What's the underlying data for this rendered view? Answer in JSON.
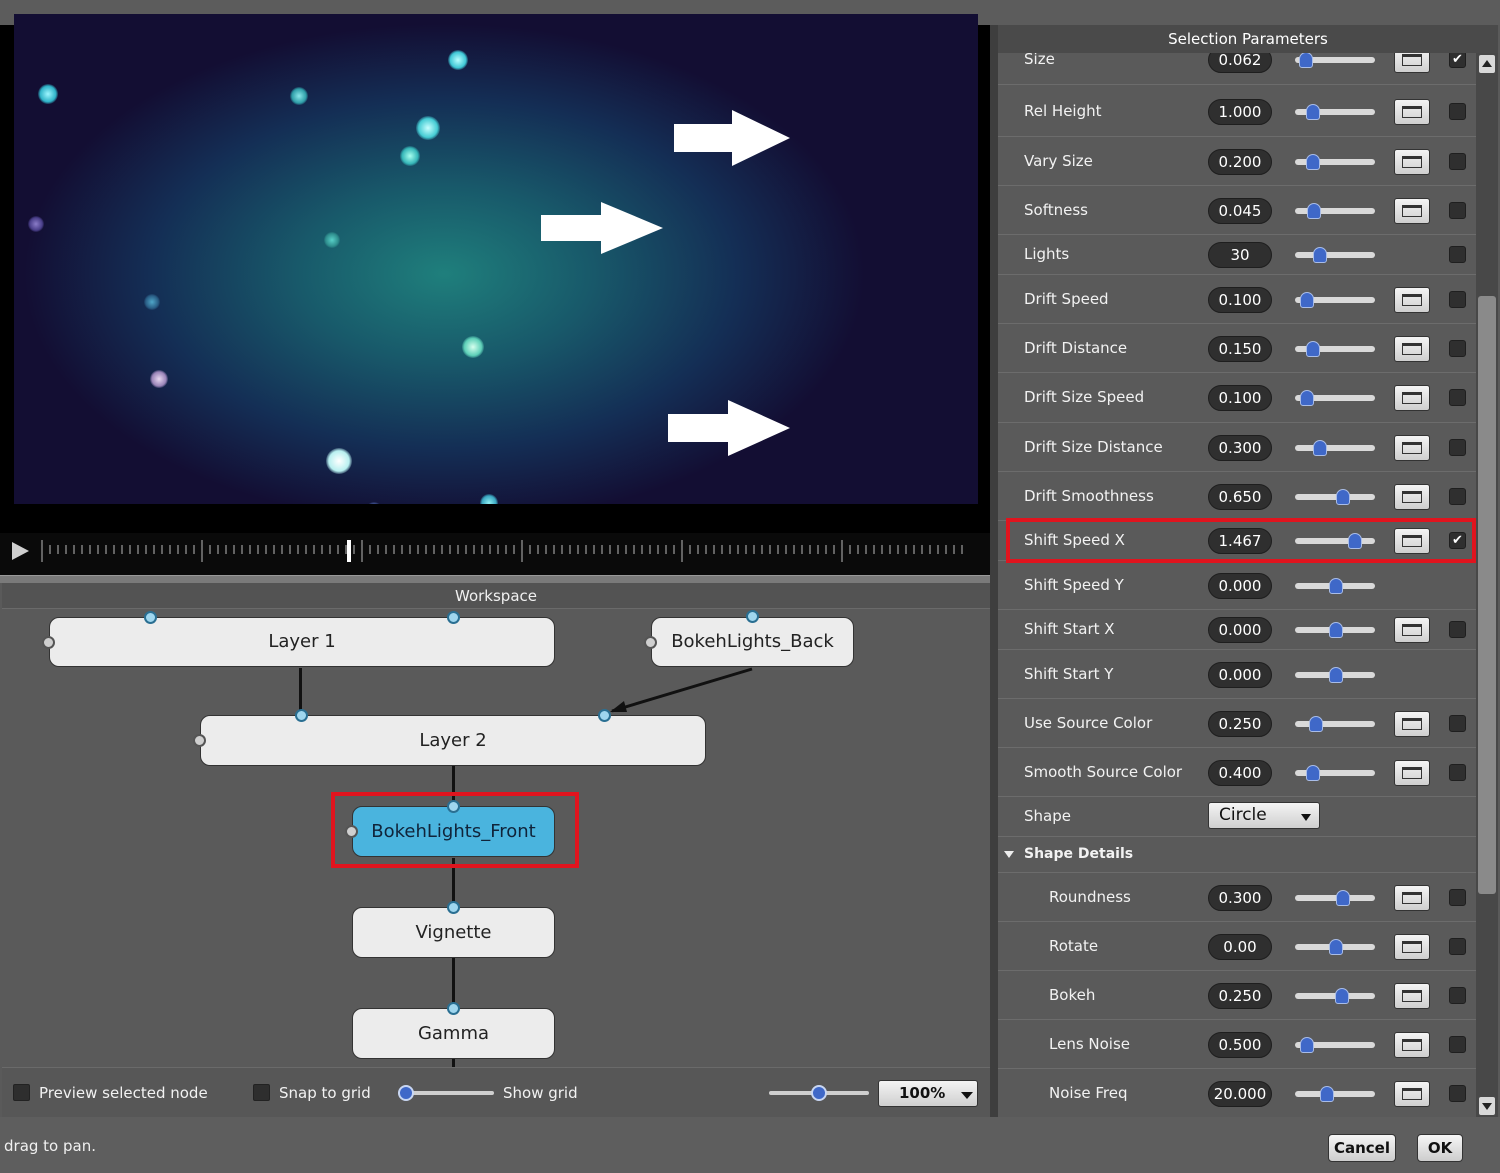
{
  "preview": {
    "arrow_color": "#ffffff",
    "background_colors": [
      "#1f7f7c",
      "#142e55",
      "#130e33"
    ]
  },
  "workspace": {
    "title": "Workspace",
    "nodes": {
      "layer1": "Layer 1",
      "bokeh_back": "BokehLights_Back",
      "layer2": "Layer 2",
      "bokeh_front": "BokehLights_Front",
      "vignette": "Vignette",
      "gamma": "Gamma"
    },
    "selected_node": "BokehLights_Front",
    "footer": {
      "preview_selected_label": "Preview selected node",
      "snap_label": "Snap to grid",
      "show_grid_label": "Show grid",
      "zoom_value": "100%"
    }
  },
  "params": {
    "title": "Selection Parameters",
    "rows": [
      {
        "name": "Size",
        "value": "0.062",
        "checked": true
      },
      {
        "name": "Rel Height",
        "value": "1.000",
        "checked": false
      },
      {
        "name": "Vary Size",
        "value": "0.200",
        "checked": false
      },
      {
        "name": "Softness",
        "value": "0.045",
        "checked": false
      },
      {
        "name": "Lights",
        "value": "30",
        "checked": false
      },
      {
        "name": "Drift Speed",
        "value": "0.100",
        "checked": false
      },
      {
        "name": "Drift Distance",
        "value": "0.150",
        "checked": false
      },
      {
        "name": "Drift Size Speed",
        "value": "0.100",
        "checked": false
      },
      {
        "name": "Drift Size Distance",
        "value": "0.300",
        "checked": false
      },
      {
        "name": "Drift Smoothness",
        "value": "0.650",
        "checked": false
      },
      {
        "name": "Shift Speed X",
        "value": "1.467",
        "checked": true
      },
      {
        "name": "Shift Speed Y",
        "value": "0.000",
        "checked": false
      },
      {
        "name": "Shift Start X",
        "value": "0.000",
        "checked": false
      },
      {
        "name": "Shift Start Y",
        "value": "0.000",
        "checked": false
      },
      {
        "name": "Use Source Color",
        "value": "0.250",
        "checked": false
      },
      {
        "name": "Smooth Source Color",
        "value": "0.400",
        "checked": false
      }
    ],
    "shape": {
      "label": "Shape",
      "value": "Circle"
    },
    "shape_details": {
      "label": "Shape Details",
      "rows": [
        {
          "name": "Roundness",
          "value": "0.300",
          "checked": false
        },
        {
          "name": "Rotate",
          "value": "0.00",
          "checked": false
        },
        {
          "name": "Bokeh",
          "value": "0.250",
          "checked": false
        },
        {
          "name": "Lens Noise",
          "value": "0.500",
          "checked": false
        },
        {
          "name": "Noise Freq",
          "value": "20.000",
          "checked": false
        }
      ]
    }
  },
  "status": {
    "text": "drag to pan.",
    "cancel": "Cancel",
    "ok": "OK"
  },
  "colors": {
    "highlight": "#e0141e",
    "selected_node": "#4ab4de",
    "slider_knob": "#3f68c8"
  }
}
